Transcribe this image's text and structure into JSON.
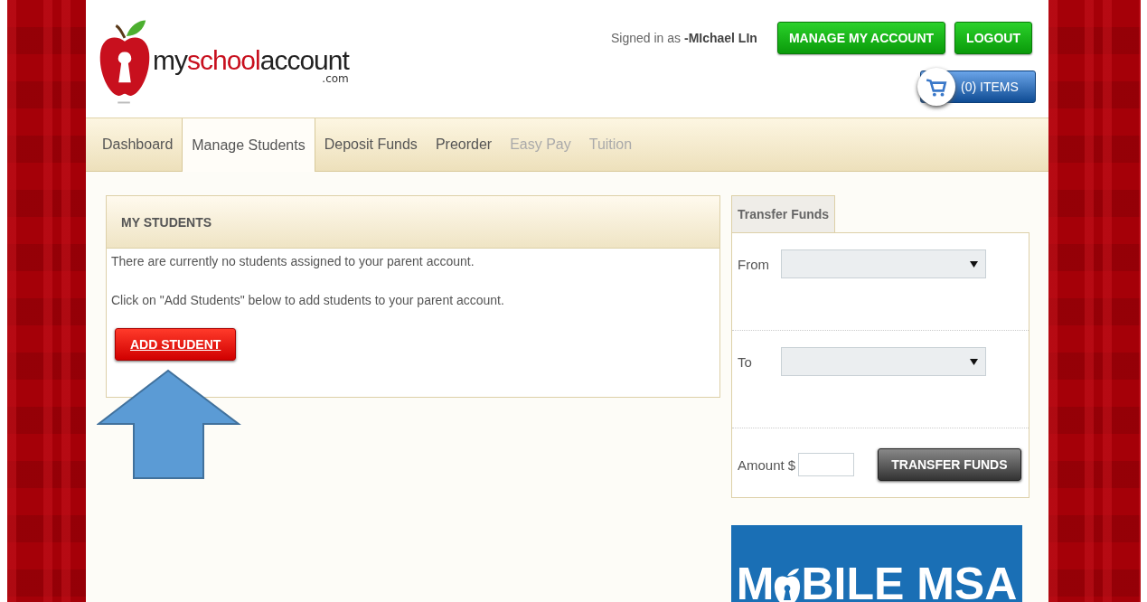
{
  "header": {
    "logo": {
      "name_parts": [
        "my",
        "school",
        "account"
      ],
      "suffix": ".com"
    },
    "signed_in": {
      "label": "Signed in as ",
      "user": "-MIchael LIn"
    },
    "buttons": [
      "MANAGE MY ACCOUNT",
      "LOGOUT"
    ],
    "cart": {
      "label": "(0) ITEMS"
    }
  },
  "tabs": [
    {
      "label": "Dashboard",
      "selected": false,
      "disabled": false
    },
    {
      "label": "Manage Students",
      "selected": true,
      "disabled": false
    },
    {
      "label": "Deposit Funds",
      "selected": false,
      "disabled": false
    },
    {
      "label": "Preorder",
      "selected": false,
      "disabled": false
    },
    {
      "label": "Easy Pay",
      "selected": false,
      "disabled": true
    },
    {
      "label": "Tuition",
      "selected": false,
      "disabled": true
    }
  ],
  "students_panel": {
    "title": "MY STUDENTS",
    "messages": [
      "There are currently no students assigned to your parent account.",
      "Click on \"Add Students\" below to add students to your parent account."
    ],
    "button": "ADD STUDENT"
  },
  "transfer_panel": {
    "tab": "Transfer Funds",
    "from_label": "From",
    "to_label": "To",
    "amount_label": "Amount $",
    "button": "TRANSFER FUNDS"
  },
  "banner": {
    "text_before": "M",
    "text_after": "BILE MSA"
  },
  "annotation": {
    "kind": "arrow"
  }
}
